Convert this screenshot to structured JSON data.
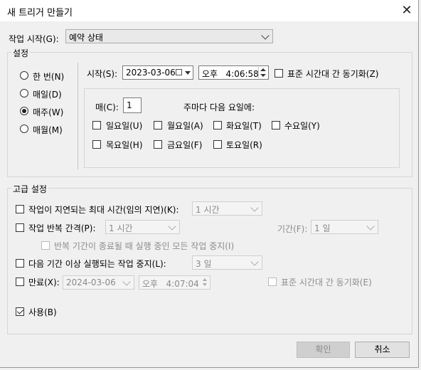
{
  "window": {
    "title": "새 트리거 만들기"
  },
  "start_task": {
    "label": "작업 시작(G):",
    "value": "예약 상태"
  },
  "settings": {
    "label": "설정",
    "radios": [
      {
        "label": "한 번(N)",
        "checked": false
      },
      {
        "label": "매일(D)",
        "checked": false
      },
      {
        "label": "매주(W)",
        "checked": true
      },
      {
        "label": "매월(M)",
        "checked": false
      }
    ],
    "start_label": "시작(S):",
    "start_date": "2023-03-06",
    "start_time": "오후   4:06:58",
    "sync_label": "표준 시간대 간 동기화(Z)",
    "every_label": "매(C):",
    "every_value": "1",
    "weekday_caption": "주마다 다음 요일에:",
    "days": [
      "일요일(U)",
      "월요일(A)",
      "화요일(T)",
      "수요일(Y)",
      "목요일(H)",
      "금요일(F)",
      "토요일(R)"
    ]
  },
  "advanced": {
    "label": "고급 설정",
    "delay_label": "작업이 지연되는 최대 시간(임의 지연)(K):",
    "delay_value": "1 시간",
    "repeat_label": "작업 반복 간격(P):",
    "repeat_value": "1 시간",
    "duration_label": "기간(F):",
    "duration_value": "1 일",
    "stop_all_label": "반복 기간이 종료될 때 실행 중인 모든 작업 중지(I)",
    "stop_longer_label": "다음 기간 이상 실행되는 작업 중지(L):",
    "stop_longer_value": "3 일",
    "expire_label": "만료(X):",
    "expire_date": "2024-03-06",
    "expire_time": "오후   4:07:04",
    "expire_sync_label": "표준 시간대 간 동기화(E)",
    "enabled_label": "사용(B)"
  },
  "buttons": {
    "ok": "확인",
    "cancel": "취소"
  }
}
